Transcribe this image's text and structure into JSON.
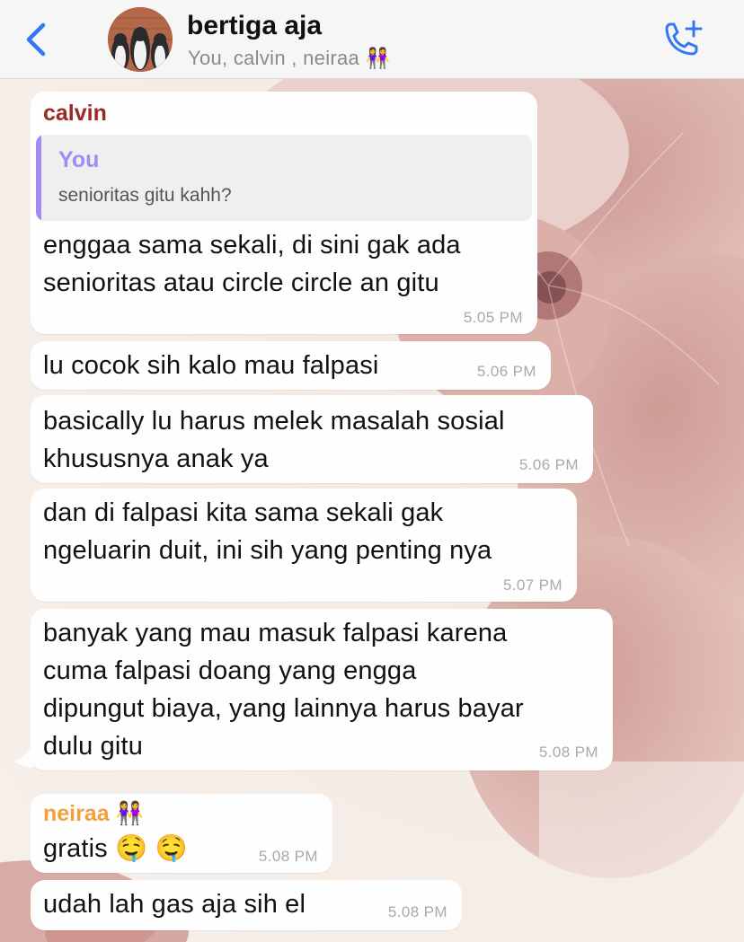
{
  "header": {
    "title": "bertiga aja",
    "subtitle": "You, calvin , neiraa 👭"
  },
  "colors": {
    "accent": "#3478f6",
    "calvin_name": "#9b2a25",
    "neiraa_name": "#f0a040",
    "quote_name": "#a28bf5"
  },
  "icons": [
    "chevron-left-icon",
    "group-avatar",
    "add-call-icon"
  ],
  "messages": [
    {
      "sender": "calvin",
      "quote": {
        "author": "You",
        "text": "senioritas gitu kahh?"
      },
      "lines": [
        "enggaa sama sekali, di sini gak ada",
        "senioritas atau circle circle an gitu"
      ],
      "time": "5.05 PM"
    },
    {
      "lines": [
        "lu cocok sih kalo mau falpasi"
      ],
      "time": "5.06 PM"
    },
    {
      "lines": [
        "basically lu harus melek masalah sosial",
        "khususnya anak ya"
      ],
      "time": "5.06 PM"
    },
    {
      "lines": [
        "dan di falpasi kita sama sekali gak",
        "ngeluarin duit, ini sih yang penting nya"
      ],
      "time": "5.07 PM"
    },
    {
      "lines": [
        "banyak yang mau masuk falpasi karena",
        "cuma falpasi doang yang engga",
        "dipungut biaya, yang lainnya harus bayar",
        "dulu gitu"
      ],
      "time": "5.08 PM"
    },
    {
      "sender": "neiraa 👭",
      "lines": [
        "gratis 🤤 🤤"
      ],
      "time": "5.08 PM"
    },
    {
      "lines": [
        "udah lah gas aja sih el"
      ],
      "time": "5.08 PM"
    }
  ]
}
